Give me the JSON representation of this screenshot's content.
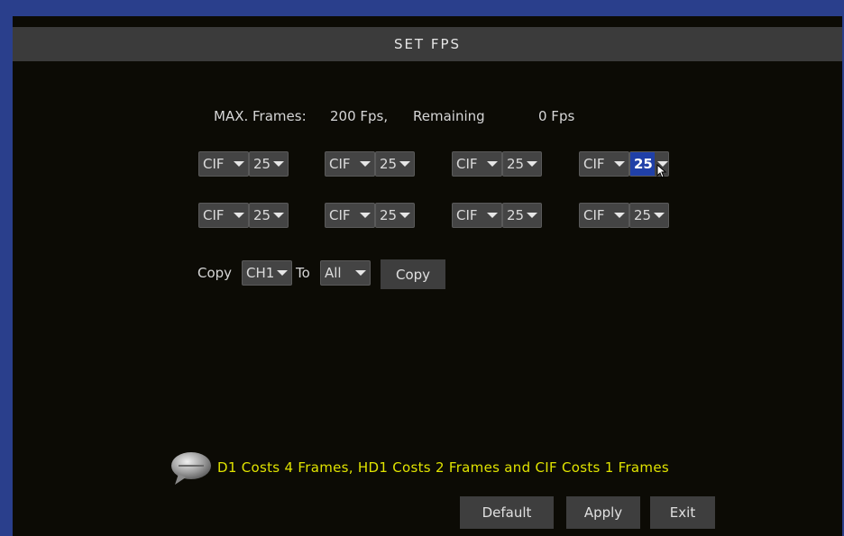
{
  "title": "SET FPS",
  "info": {
    "max_label": "MAX. Frames:",
    "max_value": "200 Fps,",
    "remaining_label": "Remaining",
    "remaining_value": "0 Fps"
  },
  "channels_row1": [
    {
      "resolution": "CIF",
      "fps": "25"
    },
    {
      "resolution": "CIF",
      "fps": "25"
    },
    {
      "resolution": "CIF",
      "fps": "25"
    },
    {
      "resolution": "CIF",
      "fps": "25"
    }
  ],
  "channels_row2": [
    {
      "resolution": "CIF",
      "fps": "25"
    },
    {
      "resolution": "CIF",
      "fps": "25"
    },
    {
      "resolution": "CIF",
      "fps": "25"
    },
    {
      "resolution": "CIF",
      "fps": "25"
    }
  ],
  "copy": {
    "label": "Copy",
    "from_value": "CH1",
    "to_label": "To",
    "to_value": "All",
    "button": "Copy"
  },
  "note": "D1  Costs  4  Frames, HD1  Costs  2  Frames  and  CIF  Costs  1 Frames",
  "buttons": {
    "default": "Default",
    "apply": "Apply",
    "exit": "Exit"
  },
  "colors": {
    "accent": "#2a3f8c",
    "note_text": "#e0e300",
    "selected": "#2040a8"
  },
  "icons": {
    "dropdown": "triangle-down-icon",
    "tip": "speech-bubble-icon",
    "pointer": "mouse-cursor-icon"
  }
}
